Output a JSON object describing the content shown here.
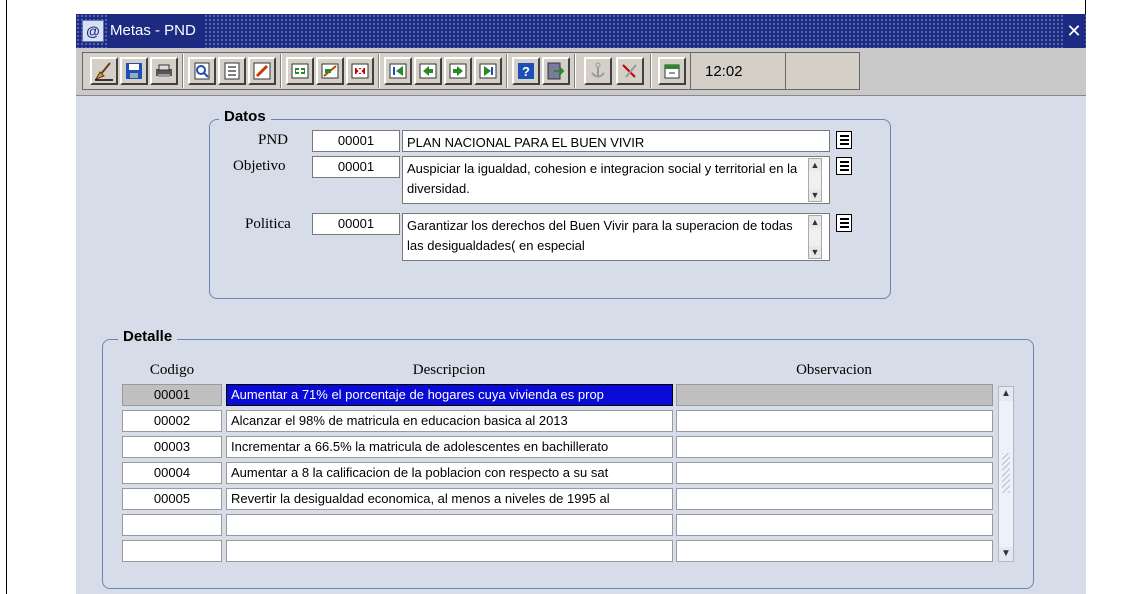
{
  "window": {
    "title": "Metas - PND",
    "close_symbol": "✕"
  },
  "toolbar": {
    "clock": "12:02",
    "buttons": [
      {
        "name": "clear-form-icon"
      },
      {
        "name": "save-icon"
      },
      {
        "name": "print-icon"
      },
      {
        "name": "query-icon"
      },
      {
        "name": "list-icon"
      },
      {
        "name": "edit-icon"
      },
      {
        "name": "insert-record-icon"
      },
      {
        "name": "duplicate-record-icon"
      },
      {
        "name": "delete-record-icon"
      },
      {
        "name": "first-record-icon"
      },
      {
        "name": "previous-record-icon"
      },
      {
        "name": "next-record-icon"
      },
      {
        "name": "last-record-icon"
      },
      {
        "name": "help-icon"
      },
      {
        "name": "exit-icon"
      },
      {
        "name": "anchor-icon"
      },
      {
        "name": "check-icon"
      },
      {
        "name": "calendar-icon"
      }
    ]
  },
  "datos": {
    "title": "Datos",
    "pnd": {
      "label": "PND",
      "code": "00001",
      "text": "PLAN NACIONAL PARA EL  BUEN VIVIR"
    },
    "objetivo": {
      "label": "Objetivo",
      "code": "00001",
      "text": "Auspiciar la igualdad, cohesion e integracion social y territorial en la diversidad."
    },
    "politica": {
      "label": "Politica",
      "code": "00001",
      "text": "Garantizar los derechos del Buen Vivir para la superacion de todas las desigualdades( en especial"
    }
  },
  "detalle": {
    "title": "Detalle",
    "headers": {
      "codigo": "Codigo",
      "descripcion": "Descripcion",
      "observacion": "Observacion"
    },
    "rows": [
      {
        "codigo": "00001",
        "descripcion": "Aumentar a 71% el porcentaje de hogares cuya vivienda es prop",
        "observacion": ""
      },
      {
        "codigo": "00002",
        "descripcion": "Alcanzar el 98% de matricula en educacion basica al 2013",
        "observacion": ""
      },
      {
        "codigo": "00003",
        "descripcion": "Incrementar a 66.5% la matricula de adolescentes en bachillerato",
        "observacion": ""
      },
      {
        "codigo": "00004",
        "descripcion": "Aumentar a 8 la calificacion de la poblacion con respecto a su sat",
        "observacion": ""
      },
      {
        "codigo": "00005",
        "descripcion": "Revertir la desigualdad economica, al menos a niveles de 1995 al",
        "observacion": ""
      },
      {
        "codigo": "",
        "descripcion": "",
        "observacion": ""
      },
      {
        "codigo": "",
        "descripcion": "",
        "observacion": ""
      }
    ]
  },
  "colors": {
    "titlebar": "#1c2a82",
    "selection": "#0a0ad6",
    "content_bg": "#d6dde8"
  }
}
